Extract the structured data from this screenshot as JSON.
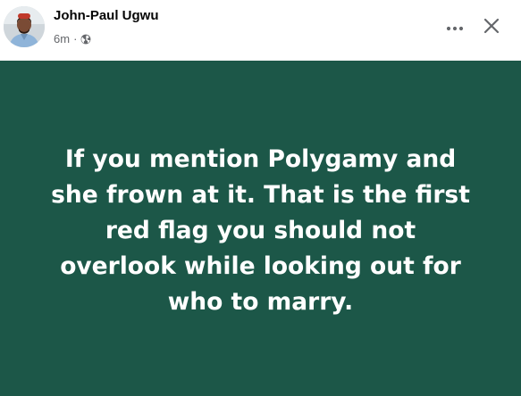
{
  "post": {
    "author": "John-Paul Ugwu",
    "timestamp": "6m",
    "separator": "·",
    "privacy_icon": "globe-icon",
    "actions": {
      "more_icon": "more-horizontal-icon",
      "close_icon": "close-icon"
    },
    "text_lines": [
      "If you mention Polygamy and",
      "she frown at it. That is the first",
      "red flag you should not",
      "overlook while looking out for",
      "who to marry."
    ],
    "colors": {
      "background": "#1c5748",
      "text": "#ffffff",
      "author": "#050505",
      "meta": "#65676b"
    }
  }
}
